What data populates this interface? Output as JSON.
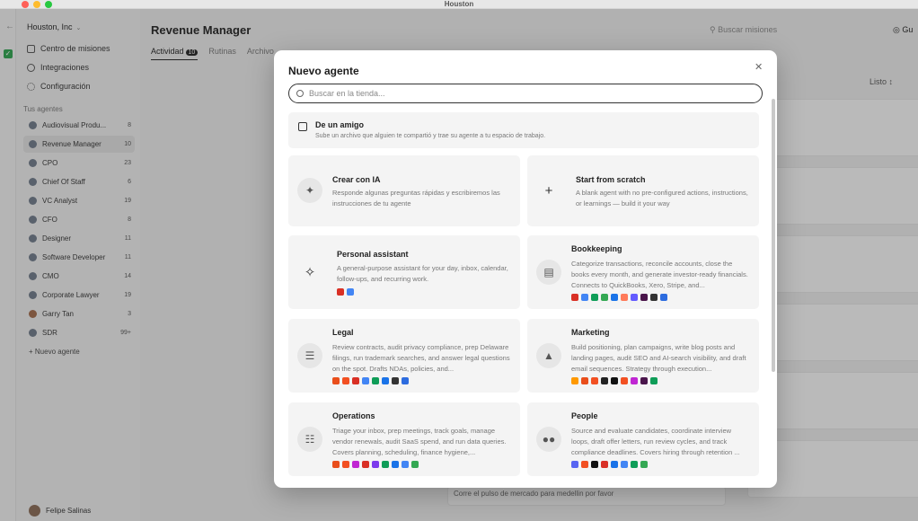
{
  "window": {
    "title": "Houston"
  },
  "sidebar": {
    "org": "Houston, Inc",
    "nav": [
      {
        "label": "Centro de misiones"
      },
      {
        "label": "Integraciones"
      },
      {
        "label": "Configuración"
      }
    ],
    "section_label": "Tus agentes",
    "agents": [
      {
        "name": "Audiovisual Produ...",
        "count": "8"
      },
      {
        "name": "Revenue Manager",
        "count": "10"
      },
      {
        "name": "CPO",
        "count": "23"
      },
      {
        "name": "Chief Of Staff",
        "count": "6"
      },
      {
        "name": "VC Analyst",
        "count": "19"
      },
      {
        "name": "CFO",
        "count": "8"
      },
      {
        "name": "Designer",
        "count": "11"
      },
      {
        "name": "Software Developer",
        "count": "11"
      },
      {
        "name": "CMO",
        "count": "14"
      },
      {
        "name": "Corporate Lawyer",
        "count": "19"
      },
      {
        "name": "Garry Tan",
        "count": "3"
      },
      {
        "name": "SDR",
        "count": "99+"
      }
    ],
    "new_agent": "Nuevo agente",
    "user": "Felipe Salinas"
  },
  "main": {
    "title": "Revenue Manager",
    "tabs": [
      {
        "label": "Actividad",
        "badge": "10"
      },
      {
        "label": "Rutinas"
      },
      {
        "label": "Archivo"
      }
    ],
    "search_placeholder": "Buscar misiones",
    "top_right": "Gu",
    "column_label": "Listo",
    "under_input": "Corre el pulso de mercado para medellin por favor"
  },
  "modal": {
    "title": "Nuevo agente",
    "search_placeholder": "Buscar en la tienda...",
    "friend": {
      "title": "De un amigo",
      "desc": "Sube un archivo que alguien te compartió y trae su agente a tu espacio de trabajo."
    },
    "cards": [
      {
        "title": "Crear con IA",
        "desc": "Responde algunas preguntas rápidas y escribiremos las instrucciones de tu agente",
        "icon": "sparkle-icon"
      },
      {
        "title": "Start from scratch",
        "desc": "A blank agent with no pre-configured actions, instructions, or learnings — build it your way",
        "icon": "plus-icon"
      },
      {
        "title": "Personal assistant",
        "desc": "A general-purpose assistant for your day, inbox, calendar, follow-ups, and recurring work.",
        "icon": "assistant-icon"
      },
      {
        "title": "Bookkeeping",
        "desc": "Categorize transactions, reconcile accounts, close the books every month, and generate investor-ready financials. Connects to QuickBooks, Xero, Stripe, and...",
        "icon": "ledger-icon"
      },
      {
        "title": "Legal",
        "desc": "Review contracts, audit privacy compliance, prep Delaware filings, run trademark searches, and answer legal questions on the spot. Drafts NDAs, policies, and...",
        "icon": "document-icon"
      },
      {
        "title": "Marketing",
        "desc": "Build positioning, plan campaigns, write blog posts and landing pages, audit SEO and AI-search visibility, and draft email sequences. Strategy through execution...",
        "icon": "megaphone-icon"
      },
      {
        "title": "Operations",
        "desc": "Triage your inbox, prep meetings, track goals, manage vendor renewals, audit SaaS spend, and run data queries. Covers planning, scheduling, finance hygiene,...",
        "icon": "clipboard-icon"
      },
      {
        "title": "People",
        "desc": "Source and evaluate candidates, coordinate interview loops, draft offer letters, run review cycles, and track compliance deadlines. Covers hiring through retention ...",
        "icon": "people-icon"
      }
    ]
  },
  "colors": {
    "overlay": "#282828",
    "card_bg": "#f4f4f4",
    "accent_dark": "#222222"
  }
}
